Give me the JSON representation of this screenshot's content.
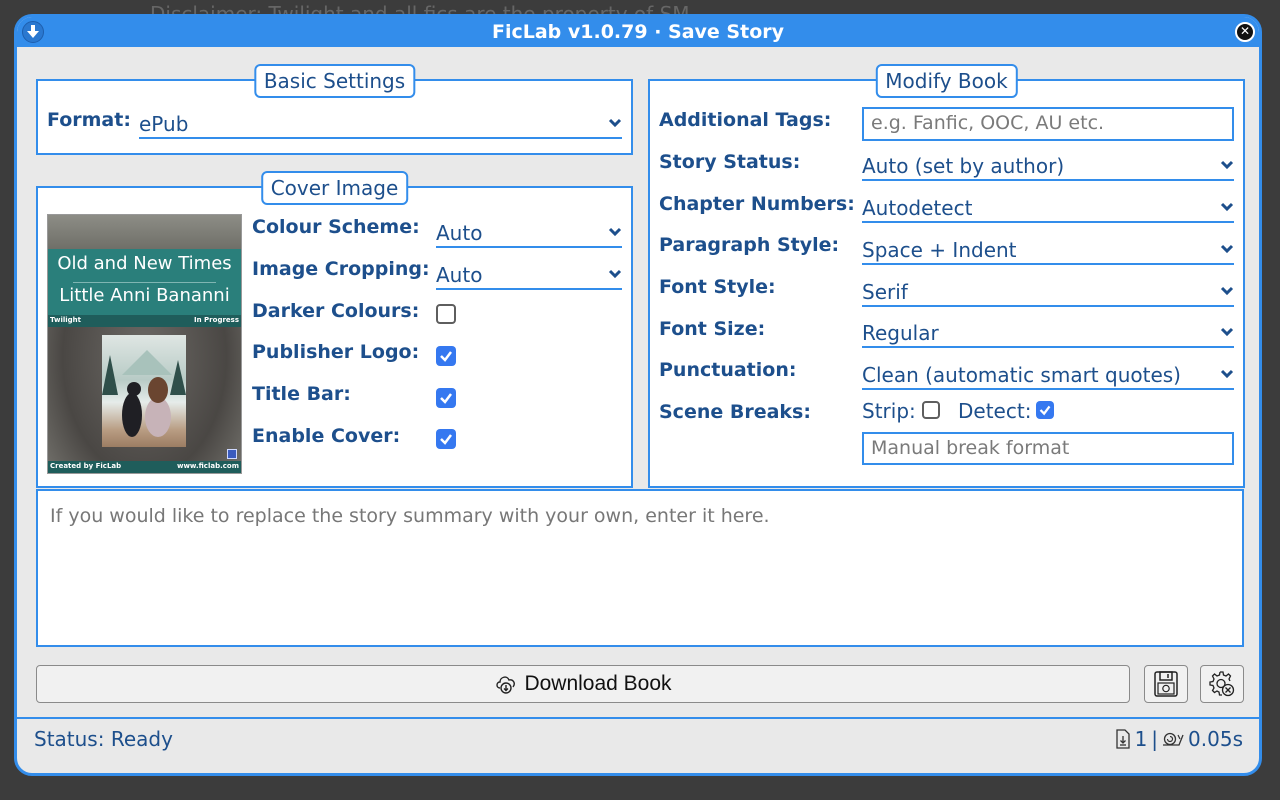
{
  "background_text": "Disclaimer: Twilight and all fics are the property of SM...",
  "window": {
    "title": "FicLab v1.0.79 · Save Story",
    "left_icon": "download-arrow-icon",
    "close_icon": "close-icon"
  },
  "basic_settings": {
    "legend": "Basic Settings",
    "format_label": "Format:",
    "format_value": "ePub"
  },
  "cover_image": {
    "legend": "Cover Image",
    "preview": {
      "title": "Old and New Times",
      "author": "Little Anni Bananni",
      "fandom": "Twilight",
      "status": "In Progress",
      "footer_left": "Created by FicLab",
      "footer_right": "www.ficlab.com"
    },
    "colour_scheme_label": "Colour Scheme:",
    "colour_scheme_value": "Auto",
    "image_cropping_label": "Image Cropping:",
    "image_cropping_value": "Auto",
    "darker_colours_label": "Darker Colours:",
    "darker_colours_checked": false,
    "publisher_logo_label": "Publisher Logo:",
    "publisher_logo_checked": true,
    "title_bar_label": "Title Bar:",
    "title_bar_checked": true,
    "enable_cover_label": "Enable Cover:",
    "enable_cover_checked": true
  },
  "modify_book": {
    "legend": "Modify Book",
    "additional_tags_label": "Additional Tags:",
    "additional_tags_placeholder": "e.g. Fanfic, OOC, AU etc.",
    "additional_tags_value": "",
    "story_status_label": "Story Status:",
    "story_status_value": "Auto (set by author)",
    "chapter_numbers_label": "Chapter Numbers:",
    "chapter_numbers_value": "Autodetect",
    "paragraph_style_label": "Paragraph Style:",
    "paragraph_style_value": "Space + Indent",
    "font_style_label": "Font Style:",
    "font_style_value": "Serif",
    "font_size_label": "Font Size:",
    "font_size_value": "Regular",
    "punctuation_label": "Punctuation:",
    "punctuation_value": "Clean (automatic smart quotes)",
    "scene_breaks_label": "Scene Breaks:",
    "strip_label": "Strip:",
    "strip_checked": false,
    "detect_label": "Detect:",
    "detect_checked": true,
    "manual_break_placeholder": "Manual break format",
    "manual_break_value": ""
  },
  "summary": {
    "placeholder": "If you would like to replace the story summary with your own, enter it here.",
    "value": ""
  },
  "actions": {
    "download_label": "Download Book",
    "download_icon": "cloud-download-icon",
    "save_settings_icon": "floppy-gear-icon",
    "reset_settings_icon": "gear-x-icon"
  },
  "status": {
    "text": "Status: Ready",
    "file_count": "1",
    "separator": "|",
    "time": "0.05s",
    "accent": "#338deb",
    "text_color": "#1d4f8c"
  }
}
